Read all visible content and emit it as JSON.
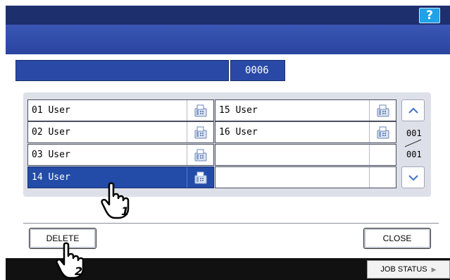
{
  "header": {
    "help_label": "?"
  },
  "info": {
    "count": "0006"
  },
  "list": {
    "left": [
      {
        "label": "01 User",
        "selected": false
      },
      {
        "label": "02 User",
        "selected": false
      },
      {
        "label": "03 User",
        "selected": false
      },
      {
        "label": "14 User",
        "selected": true
      }
    ],
    "right": [
      {
        "label": "15 User"
      },
      {
        "label": "16 User"
      },
      {
        "label": ""
      },
      {
        "label": ""
      }
    ],
    "page_current": "001",
    "page_total": "001"
  },
  "buttons": {
    "delete_label": "DELETE",
    "close_label": "CLOSE"
  },
  "footer": {
    "job_status_label": "JOB STATUS"
  },
  "callouts": {
    "step1": "1",
    "step2": "2"
  },
  "colors": {
    "header": "#1e2f6e",
    "accent": "#2a49a6",
    "selected": "#234ba8",
    "help": "#20a2e8"
  }
}
